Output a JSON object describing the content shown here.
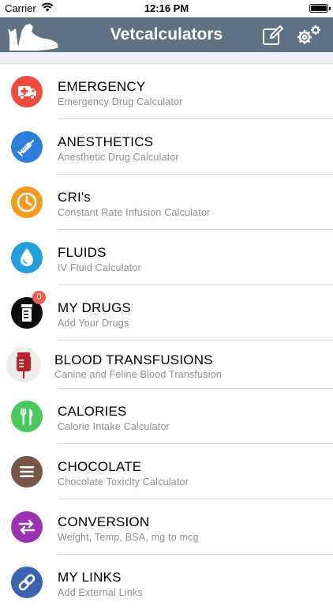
{
  "status_bar": {
    "carrier": "Carrier",
    "time": "12:16 PM"
  },
  "nav": {
    "title": "Vetcalculators"
  },
  "colors": {
    "nav_bg": "#5e7283",
    "emergency": "#ef4b3f",
    "anesthetics": "#2f7ed9",
    "cri": "#f39a1f",
    "fluids": "#23a0dc",
    "my_drugs": "#0d0d0d",
    "blood": "#b5252b",
    "calories": "#4cc75e",
    "chocolate": "#795548",
    "conversion": "#9b32b0",
    "my_links": "#3b63b0"
  },
  "menu": [
    {
      "title": "EMERGENCY",
      "subtitle": "Emergency Drug Calculator",
      "icon": "ambulance-icon"
    },
    {
      "title": "ANESTHETICS",
      "subtitle": "Anesthetic Drug Calculator",
      "icon": "syringe-icon"
    },
    {
      "title": "CRI's",
      "subtitle": "Constant Rate Infusion Calculator",
      "icon": "clock-icon"
    },
    {
      "title": "FLUIDS",
      "subtitle": "IV Fluid Calculator",
      "icon": "drop-icon"
    },
    {
      "title": "MY DRUGS",
      "subtitle": "Add Your Drugs",
      "icon": "pill-bottle-icon",
      "badge": "0"
    },
    {
      "title": "BLOOD TRANSFUSIONS",
      "subtitle": "Canine and Feline Blood Transfusion",
      "icon": "blood-bag-icon"
    },
    {
      "title": "CALORIES",
      "subtitle": "Calorie Intake Calculator",
      "icon": "utensils-icon"
    },
    {
      "title": "CHOCOLATE",
      "subtitle": "Chocolate Toxicity Calculator",
      "icon": "chocolate-icon"
    },
    {
      "title": "CONVERSION",
      "subtitle": "Weight, Temp, BSA, mg to mcg",
      "icon": "exchange-icon"
    },
    {
      "title": "MY LINKS",
      "subtitle": "Add External Links",
      "icon": "link-icon"
    }
  ]
}
